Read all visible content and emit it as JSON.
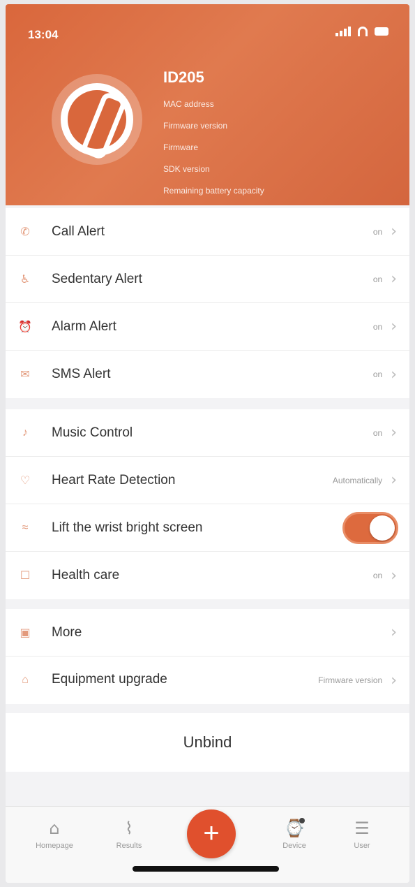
{
  "status": {
    "time": "13:04"
  },
  "device": {
    "name": "ID205",
    "lines": [
      "MAC address",
      "Firmware version",
      "Firmware",
      "SDK version",
      "Remaining battery capacity"
    ]
  },
  "groups": [
    {
      "items": [
        {
          "icon": "phone-icon",
          "glyph": "✆",
          "label": "Call Alert",
          "value": "on"
        },
        {
          "icon": "sedentary-icon",
          "glyph": "♿",
          "label": "Sedentary Alert",
          "value": "on"
        },
        {
          "icon": "alarm-icon",
          "glyph": "⏰",
          "label": "Alarm Alert",
          "value": "on"
        },
        {
          "icon": "sms-icon",
          "glyph": "✉",
          "label": "SMS Alert",
          "value": "on"
        }
      ]
    },
    {
      "items": [
        {
          "icon": "music-icon",
          "glyph": "♪",
          "label": "Music Control",
          "value": "on"
        },
        {
          "icon": "heart-rate-icon",
          "glyph": "♡",
          "label": "Heart Rate Detection",
          "value": "Automatically"
        },
        {
          "icon": "wrist-icon",
          "glyph": "≈",
          "label": "Lift the wrist bright screen",
          "toggle": true
        },
        {
          "icon": "health-icon",
          "glyph": "☐",
          "label": "Health care",
          "value": "on"
        }
      ]
    },
    {
      "items": [
        {
          "icon": "more-icon",
          "glyph": "▣",
          "label": "More",
          "value": ""
        },
        {
          "icon": "upgrade-icon",
          "glyph": "⌂",
          "label": "Equipment upgrade",
          "sub": "",
          "value": "Firmware version"
        }
      ]
    }
  ],
  "unbind": {
    "label": "Unbind"
  },
  "tabs": [
    {
      "name": "tab-homepage",
      "icon": "home-icon",
      "glyph": "⌂",
      "label": "Homepage"
    },
    {
      "name": "tab-results",
      "icon": "chart-icon",
      "glyph": "⌇",
      "label": "Results"
    },
    {
      "name": "tab-device",
      "icon": "watch-icon",
      "glyph": "⌚",
      "label": "Device"
    },
    {
      "name": "tab-user",
      "icon": "user-icon",
      "glyph": "☰",
      "label": "User"
    }
  ],
  "fab": {
    "glyph": "+"
  },
  "colors": {
    "accent": "#dd6a3e",
    "fab": "#e0502d"
  }
}
